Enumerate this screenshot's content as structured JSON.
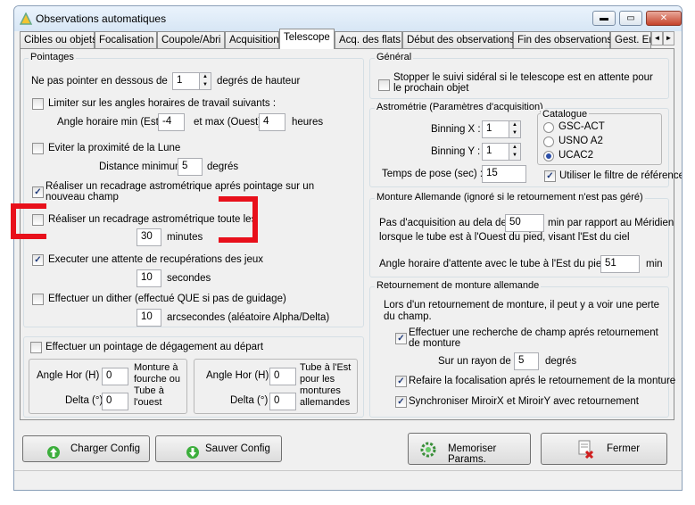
{
  "window": {
    "title": "Observations automatiques",
    "btn_min": "▬",
    "btn_max": "▭",
    "btn_close": "✕"
  },
  "tabs": [
    "Cibles ou objets",
    "Focalisation",
    "Coupole/Abri",
    "Acquisition",
    "Telescope",
    "Acq. des flats",
    "Début des observations",
    "Fin des observations",
    "Gest. Er"
  ],
  "tab_arrows": [
    "◄",
    "►"
  ],
  "pointages": {
    "title": "Pointages",
    "min_height_label": "Ne pas pointer en dessous de",
    "min_height_value": "1",
    "min_height_unit": "degrés de hauteur",
    "limit_label": "Limiter sur les angles horaires de travail suivants :",
    "ha_min_label": "Angle horaire min (Est)",
    "ha_min_value": "-4",
    "ha_max_label": "et max (Ouest)",
    "ha_max_value": "4",
    "ha_unit": "heures",
    "moon_label": "Eviter la proximité de la Lune",
    "moon_dist_label": "Distance minimum",
    "moon_dist_value": "5",
    "moon_dist_unit": "degrés",
    "recenter_new_label": "Réaliser un recadrage astrométrique aprés pointage sur un nouveau champ",
    "recenter_every_label": "Réaliser un recadrage astrométrique toute les",
    "recenter_every_value": "30",
    "recenter_every_unit": "minutes",
    "wait_label": "Executer une attente de recupérations des jeux",
    "wait_value": "10",
    "wait_unit": "secondes",
    "dither_label": "Effectuer un dither (effectué QUE si pas de guidage)",
    "dither_value": "10",
    "dither_unit": "arcsecondes (aléatoire Alpha/Delta)",
    "check": "✓"
  },
  "degagement": {
    "label": "Effectuer un pointage de dégagement au départ",
    "west": {
      "ha_label": "Angle Hor (H)",
      "ha_value": "0",
      "delta_label": "Delta (°)",
      "delta_value": "0",
      "note": [
        "Monture à",
        "fourche ou",
        "Tube à",
        "l'ouest"
      ]
    },
    "east": {
      "ha_label": "Angle Hor (H)",
      "ha_value": "0",
      "delta_label": "Delta (°)",
      "delta_value": "0",
      "note": [
        "Tube à l'Est",
        "pour les",
        "montures",
        "allemandes"
      ]
    }
  },
  "general": {
    "title": "Général",
    "stop_label": "Stopper le suivi sidéral si le telescope est en attente pour le prochain objet"
  },
  "astrometrie": {
    "title": "Astrométrie (Paramètres d'acquisition)",
    "binx_label": "Binning X :",
    "binx_value": "1",
    "biny_label": "Binning Y :",
    "biny_value": "1",
    "exposure_label": "Temps de pose (sec) :",
    "exposure_value": "15",
    "catalog_title": "Catalogue",
    "catalogs": [
      "GSC-ACT",
      "USNO A2",
      "UCAC2"
    ],
    "catalog_selected": "UCAC2",
    "ref_filter_label": "Utiliser le filtre de référence"
  },
  "monture": {
    "title": "Monture Allemande (ignoré si le retournement n'est pas géré)",
    "line1_a": "Pas d'acquisition au dela de",
    "line1_value": "50",
    "line1_b": "min par rapport au Méridien",
    "line2": "lorsque le tube est à l'Ouest du pied, visant l'Est du ciel",
    "wait_ha_label": "Angle horaire d'attente avec le tube à l'Est du pied",
    "wait_ha_value": "51",
    "wait_ha_unit": "min"
  },
  "retournement": {
    "title": "Retournement de monture allemande",
    "intro": "Lors d'un retournement de monture, il peut y a voir une perte du champ.",
    "search_label": "Effectuer une recherche de champ aprés retournement de monture",
    "radius_label": "Sur un rayon de",
    "radius_value": "5",
    "radius_unit": "degrés",
    "refocus_label": "Refaire la focalisation aprés le retournement de la monture",
    "sync_label": "Synchroniser MiroirX et MiroirY avec retournement"
  },
  "buttons": {
    "charger": "Charger Config",
    "sauver": "Sauver Config",
    "memoriser": "Memoriser Params.",
    "fermer": "Fermer"
  },
  "colors": {
    "highlight": "#e8101b",
    "accent": "#2b4ea8"
  }
}
